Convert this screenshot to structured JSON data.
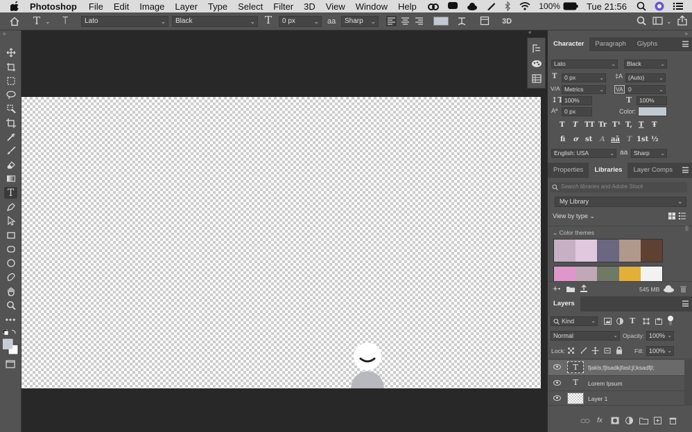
{
  "menubar": {
    "app_name": "Photoshop",
    "items": [
      "File",
      "Edit",
      "Image",
      "Layer",
      "Type",
      "Select",
      "Filter",
      "3D",
      "View",
      "Window",
      "Help"
    ],
    "battery": "100%",
    "clock": "Tue 21:56"
  },
  "options": {
    "font_family": "Lato",
    "font_style": "Black",
    "font_size": "0 px",
    "aa_label": "a",
    "antialias": "Sharp",
    "three_d": "3D"
  },
  "character": {
    "tabs": [
      "Character",
      "Paragraph",
      "Glyphs"
    ],
    "font_family": "Lato",
    "font_style": "Black",
    "size": "0 px",
    "leading": "(Auto)",
    "kerning_label": "V/A",
    "kerning": "Metrics",
    "tracking_label": "VA",
    "tracking": "0",
    "vscale": "100%",
    "hscale": "100%",
    "baseline": "0 px",
    "color_label": "Color:",
    "color": "#c2c9d3",
    "style_buttons": [
      "T",
      "T",
      "TT",
      "Tr",
      "T¹",
      "T,",
      "T",
      "Ŧ"
    ],
    "ot_buttons": [
      "fi",
      "ơ",
      "st",
      "A",
      "aā",
      "T",
      "1st",
      "½"
    ],
    "language": "English: USA",
    "aa_label": "a",
    "antialias": "Sharp"
  },
  "libraries": {
    "tabs": [
      "Properties",
      "Libraries",
      "Layer Comps"
    ],
    "search_placeholder": "Search libraries and Adobe Stock",
    "library": "My Library",
    "view_by": "View by type",
    "section": "Color themes",
    "theme1": [
      "#c8b0c4",
      "#e0c8de",
      "#6a6780",
      "#b0998a",
      "#5e4132"
    ],
    "theme2": [
      "#e096cc",
      "#c0a8b6",
      "#707866",
      "#e2b038",
      "#f2f2f2"
    ],
    "storage": "545 MB"
  },
  "layers": {
    "tab": "Layers",
    "kind": "Kind",
    "blend_mode": "Normal",
    "opacity_label": "Opacity:",
    "opacity": "100%",
    "lock_label": "Lock:",
    "fill_label": "Fill:",
    "fill": "100%",
    "items": [
      {
        "name": "fjakls;fjlsadkjfasl;jl;ksadfjl;",
        "type": "text"
      },
      {
        "name": "Lorem Ipsum",
        "type": "text"
      },
      {
        "name": "Layer 1",
        "type": "pixel"
      }
    ],
    "text_glyph": "T",
    "fx_label": "fx"
  },
  "toolbar": {
    "tools": [
      "move-tool",
      "artboard-tool",
      "marquee-tool",
      "lasso-tool",
      "quick-select-tool",
      "crop-tool",
      "eyedropper-tool",
      "brush-tool",
      "eraser-tool",
      "gradient-tool",
      "type-tool",
      "pen-tool",
      "path-select-tool",
      "rectangle-tool",
      "rounded-rect-tool",
      "ellipse-tool",
      "custom-shape-tool",
      "hand-tool",
      "zoom-tool",
      "more-tools"
    ],
    "active": "type-tool"
  }
}
